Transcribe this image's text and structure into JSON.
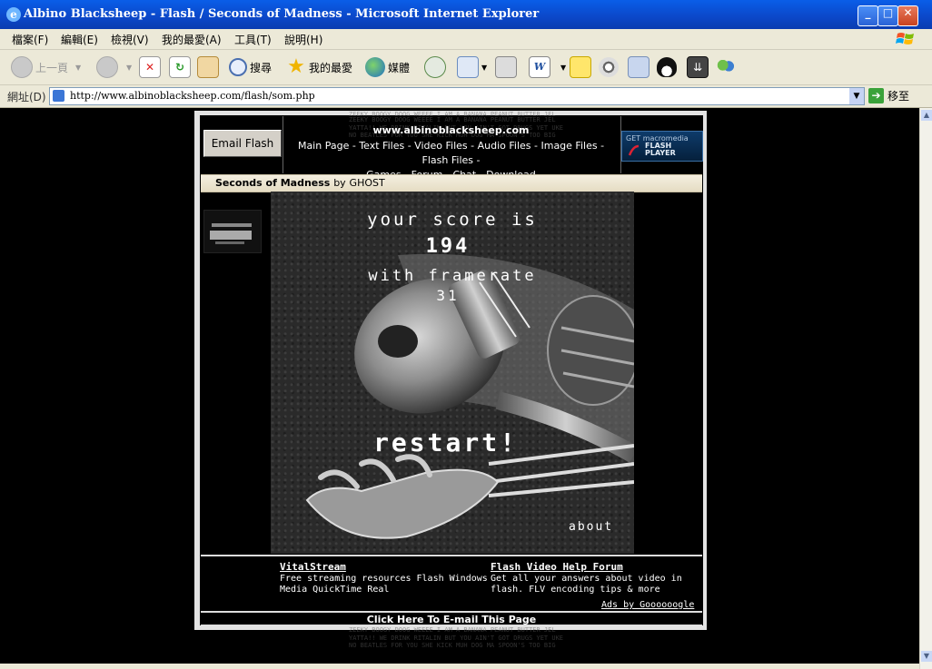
{
  "window": {
    "title": "Albino Blacksheep - Flash / Seconds of Madness - Microsoft Internet Explorer"
  },
  "menu": [
    "檔案(F)",
    "編輯(E)",
    "檢視(V)",
    "我的最愛(A)",
    "工具(T)",
    "說明(H)"
  ],
  "toolbar": {
    "back": "上一頁",
    "search": "搜尋",
    "favorites": "我的最愛",
    "media": "媒體"
  },
  "address": {
    "label": "網址(D)",
    "url": "http://www.albinoblacksheep.com/flash/som.php",
    "go": "移至"
  },
  "page": {
    "email_flash": "Email Flash",
    "site": "www.albinoblacksheep.com",
    "nav": [
      "Main Page",
      "Text Files",
      "Video Files",
      "Audio Files",
      "Image Files",
      "Flash Files",
      "Games",
      "Forum",
      "Chat",
      "Download"
    ],
    "get_flash": {
      "get": "GET",
      "brand": "macromedia",
      "line1": "FLASH",
      "line2": "PLAYER"
    },
    "flash_title": "Seconds of Madness",
    "by": "by",
    "author": "GHOST",
    "game": {
      "score_label": "your score is",
      "score": "194",
      "framerate_label": "with framerate",
      "framerate": "31",
      "restart": "restart!",
      "about": "about"
    },
    "ads": [
      {
        "title": "VitalStream",
        "text": "Free streaming resources Flash Windows Media QuickTime Real"
      },
      {
        "title": "Flash Video Help Forum",
        "text": "Get all your answers about video in flash. FLV encoding tips & more"
      }
    ],
    "ads_by": "Ads by Goooooogle",
    "email_page": "Click Here To E-mail This Page",
    "bg_text": "ZEEKY BOOGY DOOG WEEEE I AM A BANANA PEANUT BUTTER JEL\nYATTA!! WE DRINK RITALIN BUT YOU AIN'T GOT DRUGS YET UKE\nNO BEATLES FOR YOU SHE KICK MUH DOG MA SPOON'S TOO BIG"
  },
  "colors": {
    "titlebar": "#0b47c8",
    "chrome": "#ece9d8",
    "page_bg": "#000000",
    "frame": "#e3e3e3"
  }
}
